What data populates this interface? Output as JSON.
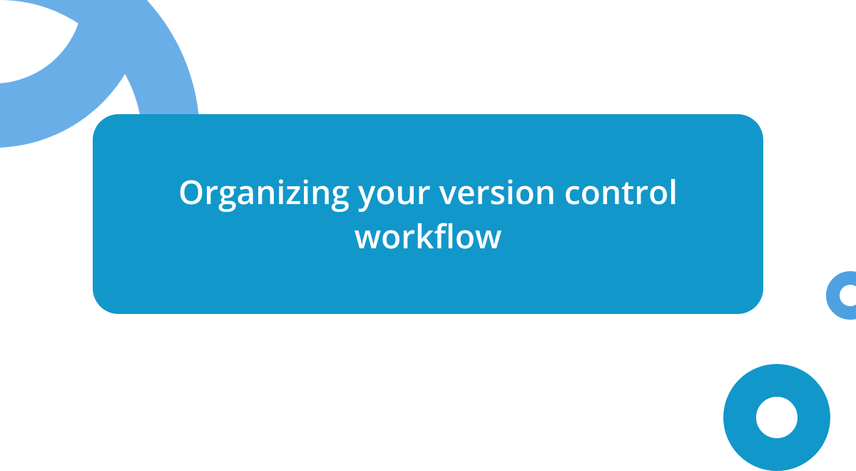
{
  "card": {
    "title": "Organizing your version control workflow"
  },
  "colors": {
    "accent_primary": "#1297ca",
    "accent_light": "#6aaee8",
    "accent_medium": "#4ea1e0",
    "background": "#ffffff"
  }
}
